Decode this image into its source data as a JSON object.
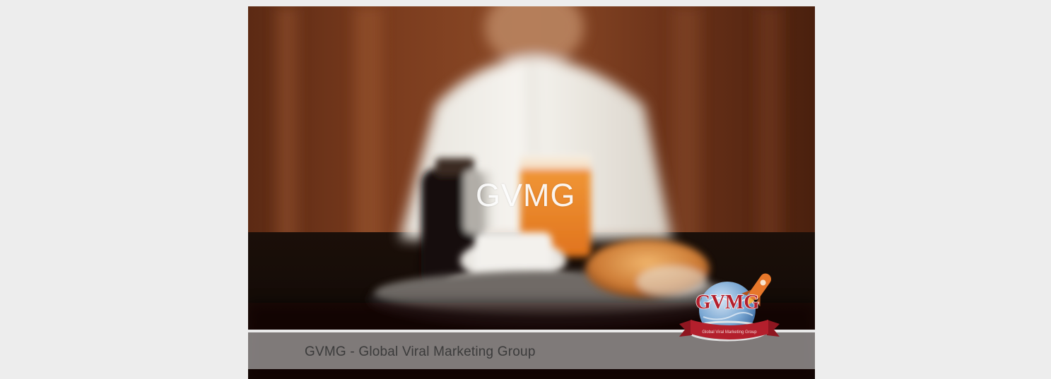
{
  "video": {
    "overlay_title": "GVMG",
    "caption": "GVMG - Global Viral Marketing Group"
  },
  "logo": {
    "wordmark": "GVMG",
    "ribbon_text": "Global Viral Marketing Group",
    "icon": "rocket-globe-logo"
  },
  "colors": {
    "page_background": "#ededed",
    "caption_background": "#c4c4c4",
    "caption_text": "#3b3b3b",
    "logo_red": "#b31f2c",
    "logo_blue": "#4a7fb8",
    "rocket_orange": "#e7772a"
  }
}
